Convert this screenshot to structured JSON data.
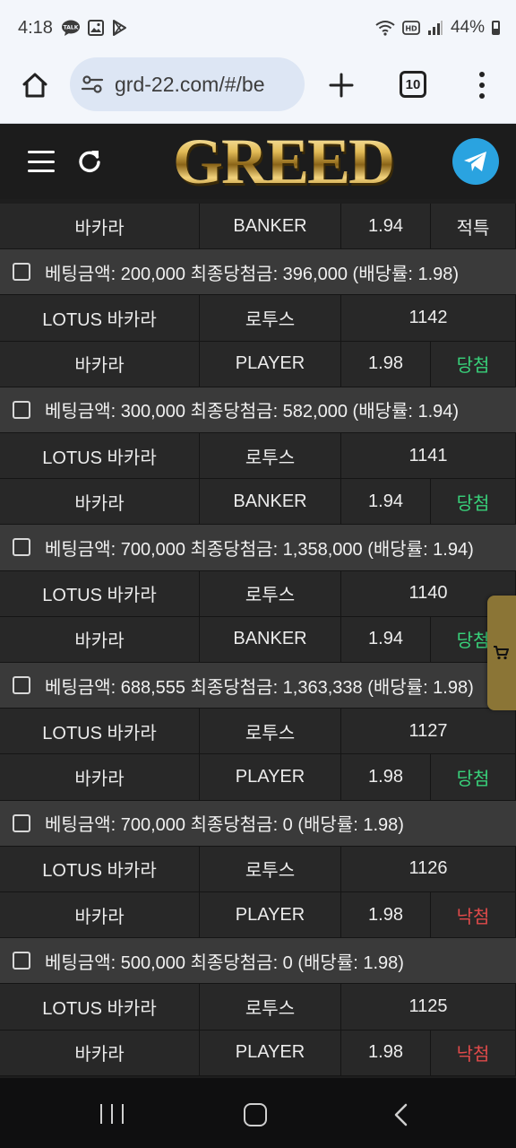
{
  "status_bar": {
    "time": "4:18",
    "battery": "44%"
  },
  "browser": {
    "url": "grd-22.com/#/be",
    "tab_count": "10"
  },
  "header": {
    "logo": "GREED"
  },
  "rows": [
    {
      "kind": "detail",
      "game": "바카라",
      "pick": "BANKER",
      "odds": "1.94",
      "result": "적특",
      "result_type": "neutral"
    },
    {
      "kind": "bet",
      "label": "베팅금액: 200,000 최종당첨금: 396,000 (배당률: 1.98)"
    },
    {
      "kind": "game",
      "game": "LOTUS 바카라",
      "category": "로투스",
      "round": "1142"
    },
    {
      "kind": "detail",
      "game": "바카라",
      "pick": "PLAYER",
      "odds": "1.98",
      "result": "당첨",
      "result_type": "win"
    },
    {
      "kind": "bet",
      "label": "베팅금액: 300,000 최종당첨금: 582,000 (배당률: 1.94)"
    },
    {
      "kind": "game",
      "game": "LOTUS 바카라",
      "category": "로투스",
      "round": "1141"
    },
    {
      "kind": "detail",
      "game": "바카라",
      "pick": "BANKER",
      "odds": "1.94",
      "result": "당첨",
      "result_type": "win"
    },
    {
      "kind": "bet",
      "label": "베팅금액: 700,000 최종당첨금: 1,358,000 (배당률: 1.94)"
    },
    {
      "kind": "game",
      "game": "LOTUS 바카라",
      "category": "로투스",
      "round": "1140"
    },
    {
      "kind": "detail",
      "game": "바카라",
      "pick": "BANKER",
      "odds": "1.94",
      "result": "당첨",
      "result_type": "win"
    },
    {
      "kind": "bet",
      "label": "베팅금액: 688,555 최종당첨금: 1,363,338 (배당률: 1.98)"
    },
    {
      "kind": "game",
      "game": "LOTUS 바카라",
      "category": "로투스",
      "round": "1127"
    },
    {
      "kind": "detail",
      "game": "바카라",
      "pick": "PLAYER",
      "odds": "1.98",
      "result": "당첨",
      "result_type": "win"
    },
    {
      "kind": "bet",
      "label": "베팅금액: 700,000 최종당첨금: 0 (배당률: 1.98)"
    },
    {
      "kind": "game",
      "game": "LOTUS 바카라",
      "category": "로투스",
      "round": "1126"
    },
    {
      "kind": "detail",
      "game": "바카라",
      "pick": "PLAYER",
      "odds": "1.98",
      "result": "낙첨",
      "result_type": "lose"
    },
    {
      "kind": "bet",
      "label": "베팅금액: 500,000 최종당첨금: 0 (배당률: 1.98)"
    },
    {
      "kind": "game",
      "game": "LOTUS 바카라",
      "category": "로투스",
      "round": "1125"
    },
    {
      "kind": "detail",
      "game": "바카라",
      "pick": "PLAYER",
      "odds": "1.98",
      "result": "낙첨",
      "result_type": "lose"
    }
  ],
  "colors": {
    "win": "#38d17a",
    "lose": "#e04a4a",
    "header_bg": "#1c1c1c",
    "cart_tab": "#8b7536",
    "telegram": "#2aa3e0"
  },
  "icons": {
    "home": "home-icon",
    "site_settings": "site-settings-icon",
    "new_tab": "plus-icon",
    "tabs": "tab-count-icon",
    "menu": "more-vert-icon",
    "hamburger": "hamburger-icon",
    "refresh": "refresh-icon",
    "telegram": "telegram-icon",
    "cart": "cart-icon"
  }
}
